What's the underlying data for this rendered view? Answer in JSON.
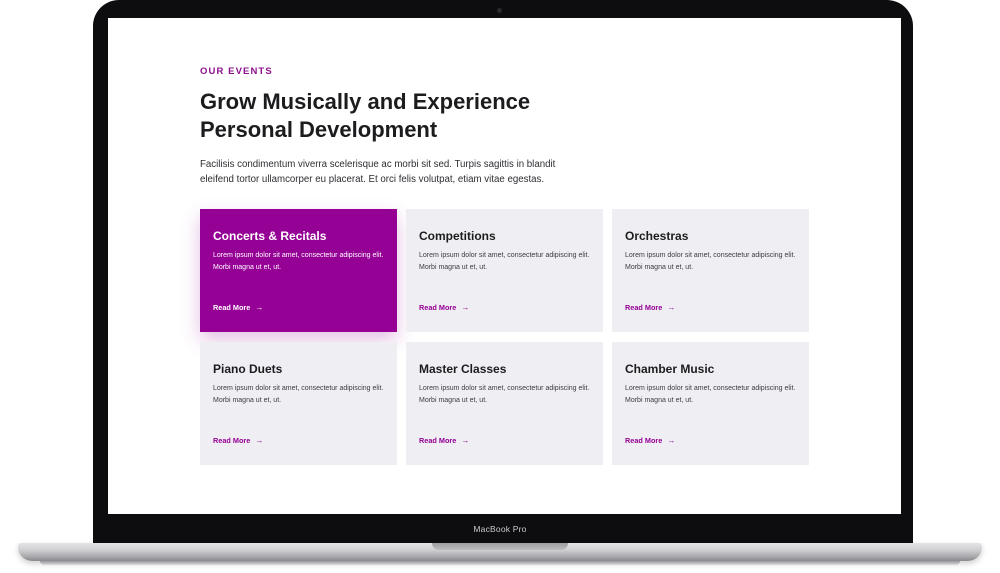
{
  "device": {
    "brand_label": "MacBook Pro"
  },
  "section": {
    "eyebrow": "OUR EVENTS",
    "headline": "Grow Musically and Experience Personal Development",
    "intro": "Facilisis condimentum viverra scelerisque ac morbi sit sed. Turpis sagittis in blandit eleifend tortor ullamcorper eu placerat. Et orci felis volutpat, etiam vitae egestas."
  },
  "cards": [
    {
      "title": "Concerts & Recitals",
      "text": "Lorem ipsum dolor sit amet, consectetur adipiscing elit. Morbi magna ut et, ut.",
      "link": "Read More",
      "active": true
    },
    {
      "title": "Competitions",
      "text": "Lorem ipsum dolor sit amet, consectetur adipiscing elit. Morbi magna ut et, ut.",
      "link": "Read More",
      "active": false
    },
    {
      "title": "Orchestras",
      "text": "Lorem ipsum dolor sit amet, consectetur adipiscing elit. Morbi magna ut et, ut.",
      "link": "Read More",
      "active": false
    },
    {
      "title": "Piano Duets",
      "text": "Lorem ipsum dolor sit amet, consectetur adipiscing elit. Morbi magna ut et, ut.",
      "link": "Read More",
      "active": false
    },
    {
      "title": "Master Classes",
      "text": "Lorem ipsum dolor sit amet, consectetur adipiscing elit. Morbi magna ut et, ut.",
      "link": "Read More",
      "active": false
    },
    {
      "title": "Chamber Music",
      "text": "Lorem ipsum dolor sit amet, consectetur adipiscing elit. Morbi magna ut et, ut.",
      "link": "Read More",
      "active": false
    }
  ],
  "icons": {
    "link_arrow": "arrow-right-icon"
  },
  "colors": {
    "accent": "#950095",
    "card_bg": "#efeff3",
    "heading": "#1c1c1f"
  }
}
